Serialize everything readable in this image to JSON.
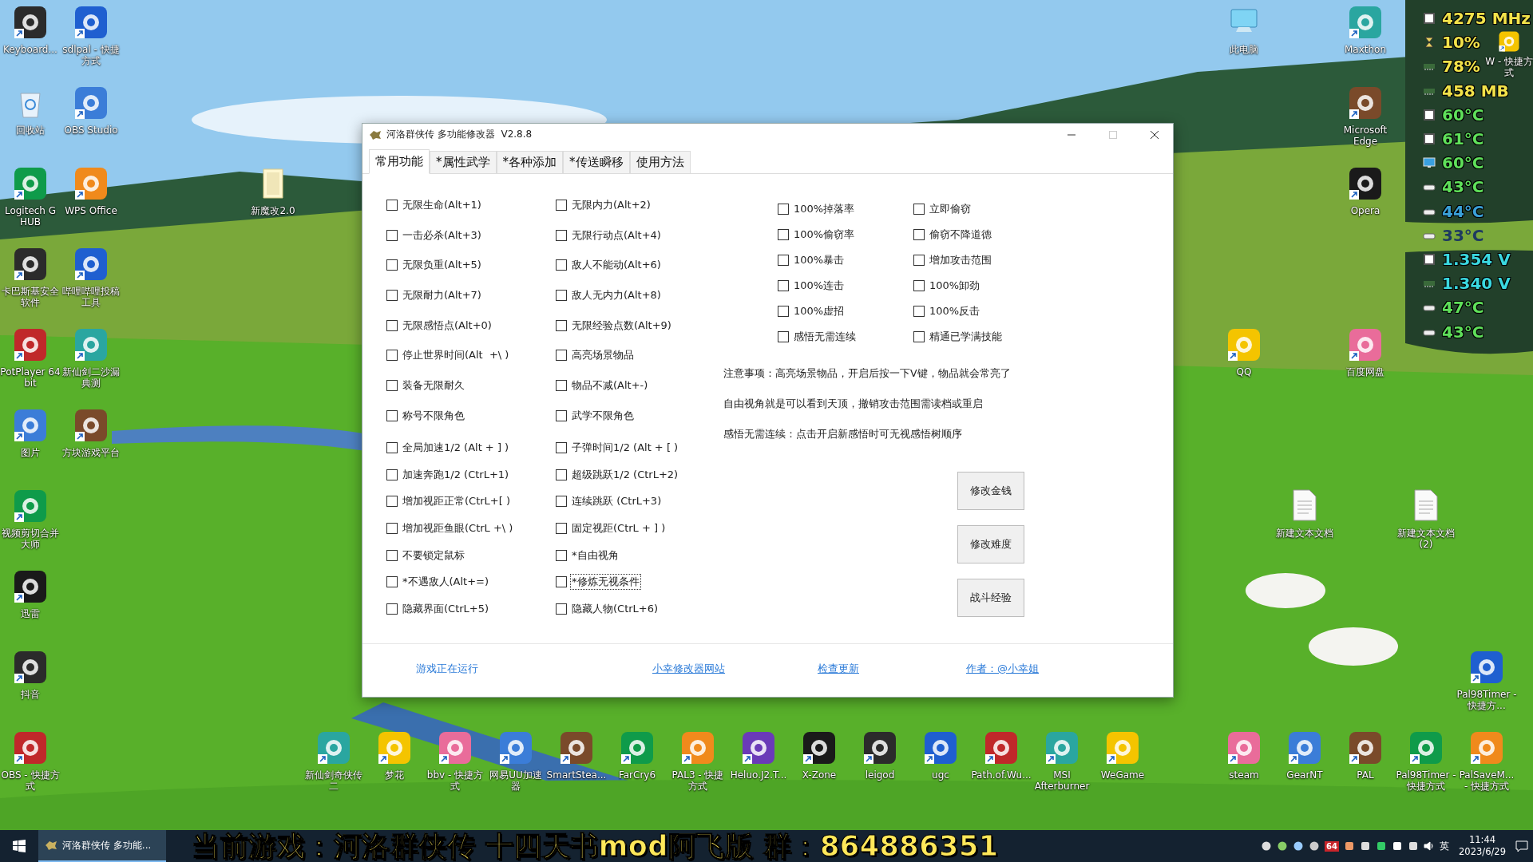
{
  "desktop_icons": [
    {
      "label": "Keyboard...",
      "kind": "app"
    },
    {
      "label": "sdlpal - 快捷方式",
      "kind": "app"
    },
    {
      "label": "此电脑",
      "kind": "computer"
    },
    {
      "label": "Maxthon",
      "kind": "app"
    },
    {
      "label": "W - 快捷方式",
      "kind": "app"
    },
    {
      "label": "回收站",
      "kind": "recycle"
    },
    {
      "label": "OBS Studio",
      "kind": "app"
    },
    {
      "label": "Microsoft Edge",
      "kind": "app"
    },
    {
      "label": "Logitech G HUB",
      "kind": "app"
    },
    {
      "label": "WPS Office",
      "kind": "app"
    },
    {
      "label": "新魔改2.0",
      "kind": "folder"
    },
    {
      "label": "Opera",
      "kind": "app"
    },
    {
      "label": "卡巴斯基安全软件",
      "kind": "app"
    },
    {
      "label": "哔哩哔哩投稿工具",
      "kind": "app"
    },
    {
      "label": "PotPlayer 64 bit",
      "kind": "app"
    },
    {
      "label": "新仙剑二沙漏典测",
      "kind": "app"
    },
    {
      "label": "QQ",
      "kind": "app"
    },
    {
      "label": "百度网盘",
      "kind": "app"
    },
    {
      "label": "图片",
      "kind": "app"
    },
    {
      "label": "方块游戏平台",
      "kind": "app"
    },
    {
      "label": "视频剪切合并大师",
      "kind": "app"
    },
    {
      "label": "新建文本文档",
      "kind": "document"
    },
    {
      "label": "新建文本文档 (2)",
      "kind": "document"
    },
    {
      "label": "迅雷",
      "kind": "app"
    },
    {
      "label": "抖音",
      "kind": "app"
    },
    {
      "label": "Pal98Timer - 快捷方...",
      "kind": "app"
    },
    {
      "label": "OBS - 快捷方式",
      "kind": "app"
    },
    {
      "label": "新仙剑奇侠传二",
      "kind": "app"
    },
    {
      "label": "梦花",
      "kind": "app"
    },
    {
      "label": "bbv - 快捷方式",
      "kind": "app"
    },
    {
      "label": "网易UU加速器",
      "kind": "app"
    },
    {
      "label": "SmartStea...",
      "kind": "app"
    },
    {
      "label": "FarCry6",
      "kind": "app"
    },
    {
      "label": "PAL3 - 快捷方式",
      "kind": "app"
    },
    {
      "label": "Heluo.J2.T...",
      "kind": "app"
    },
    {
      "label": "X-Zone",
      "kind": "app"
    },
    {
      "label": "leigod",
      "kind": "app"
    },
    {
      "label": "ugc",
      "kind": "app"
    },
    {
      "label": "Path.of.Wu...",
      "kind": "app"
    },
    {
      "label": "MSI Afterburner",
      "kind": "app"
    },
    {
      "label": "WeGame",
      "kind": "app"
    },
    {
      "label": "steam",
      "kind": "app"
    },
    {
      "label": "GearNT",
      "kind": "app"
    },
    {
      "label": "PAL",
      "kind": "app"
    },
    {
      "label": "Pal98Timer - 快捷方式",
      "kind": "app"
    },
    {
      "label": "PalSaveM... - 快捷方式",
      "kind": "app"
    }
  ],
  "sensors": [
    {
      "kind": "chip",
      "value": "4275 MHz",
      "color": "#f2e24a"
    },
    {
      "kind": "hourglass",
      "value": "10%",
      "color": "#f2e24a"
    },
    {
      "kind": "ram",
      "value": "78%",
      "color": "#f2e24a"
    },
    {
      "kind": "ram",
      "value": "458 MB",
      "color": "#f2e24a"
    },
    {
      "kind": "chip",
      "value": "60°C",
      "color": "#5fe05a"
    },
    {
      "kind": "chip",
      "value": "61°C",
      "color": "#5fe05a"
    },
    {
      "kind": "monitor",
      "value": "60°C",
      "color": "#5fe05a"
    },
    {
      "kind": "drive",
      "value": "43°C",
      "color": "#5fe05a"
    },
    {
      "kind": "drive",
      "value": "44°C",
      "color": "#3aa0d8"
    },
    {
      "kind": "drive",
      "value": "33°C",
      "color": "#1e3a60"
    },
    {
      "kind": "chip",
      "value": "1.354 V",
      "color": "#3ad8e0"
    },
    {
      "kind": "ram",
      "value": "1.340 V",
      "color": "#3ad8e0"
    },
    {
      "kind": "drive",
      "value": "47°C",
      "color": "#5fe05a"
    },
    {
      "kind": "drive",
      "value": "43°C",
      "color": "#5fe05a"
    }
  ],
  "window": {
    "title": "河洛群侠传 多功能修改器  V2.8.8",
    "maximize_disabled": true,
    "tabs": [
      {
        "label": "常用功能",
        "selected": true
      },
      {
        "label": "*属性武学",
        "selected": false
      },
      {
        "label": "*各种添加",
        "selected": false
      },
      {
        "label": "*传送瞬移",
        "selected": false
      },
      {
        "label": "使用方法",
        "selected": false
      }
    ],
    "options_group_1": [
      {
        "label": "无限生命(Alt+1)",
        "checked": false,
        "focused": false
      },
      {
        "label": "无限内力(Alt+2)",
        "checked": false,
        "focused": false
      },
      {
        "label": "一击必杀(Alt+3)",
        "checked": false,
        "focused": false
      },
      {
        "label": "无限行动点(Alt+4)",
        "checked": false,
        "focused": false
      },
      {
        "label": "无限负重(Alt+5)",
        "checked": false,
        "focused": false
      },
      {
        "label": "敌人不能动(Alt+6)",
        "checked": false,
        "focused": false
      },
      {
        "label": "无限耐力(Alt+7)",
        "checked": false,
        "focused": false
      },
      {
        "label": "敌人无内力(Alt+8)",
        "checked": false,
        "focused": false
      },
      {
        "label": "无限感悟点(Alt+0)",
        "checked": false,
        "focused": false
      },
      {
        "label": "无限经验点数(Alt+9)",
        "checked": false,
        "focused": false
      },
      {
        "label": "停止世界时间(Alt  +\\ )",
        "checked": false,
        "focused": false
      },
      {
        "label": "高亮场景物品",
        "checked": false,
        "focused": false
      },
      {
        "label": "装备无限耐久",
        "checked": false,
        "focused": false
      },
      {
        "label": "物品不减(Alt+-)",
        "checked": false,
        "focused": false
      },
      {
        "label": "称号不限角色",
        "checked": false,
        "focused": false
      },
      {
        "label": "武学不限角色",
        "checked": false,
        "focused": false
      }
    ],
    "options_group_2": [
      {
        "label": "全局加速1/2 (Alt + ] )",
        "checked": false,
        "focused": false
      },
      {
        "label": "子弹时间1/2 (Alt + [ )",
        "checked": false,
        "focused": false
      },
      {
        "label": "加速奔跑1/2 (CtrL+1)",
        "checked": false,
        "focused": false
      },
      {
        "label": "超级跳跃1/2 (CtrL+2)",
        "checked": false,
        "focused": false
      },
      {
        "label": "增加视距正常(CtrL+[ )",
        "checked": false,
        "focused": false
      },
      {
        "label": "连续跳跃 (CtrL+3)",
        "checked": false,
        "focused": false
      },
      {
        "label": "增加视距鱼眼(CtrL +\\ )",
        "checked": false,
        "focused": false
      },
      {
        "label": "固定视距(CtrL + ] )",
        "checked": false,
        "focused": false
      },
      {
        "label": "不要锁定鼠标",
        "checked": false,
        "focused": false
      },
      {
        "label": "*自由视角",
        "checked": false,
        "focused": false
      },
      {
        "label": "*不遇敌人(Alt+=)",
        "checked": false,
        "focused": false
      },
      {
        "label": "*修炼无视条件",
        "checked": false,
        "focused": true
      },
      {
        "label": "隐藏界面(CtrL+5)",
        "checked": false,
        "focused": false
      },
      {
        "label": "隐藏人物(CtrL+6)",
        "checked": false,
        "focused": false
      }
    ],
    "options_group_3": [
      {
        "label": "100%掉落率",
        "checked": false,
        "focused": false
      },
      {
        "label": "立即偷窃",
        "checked": false,
        "focused": false
      },
      {
        "label": "100%偷窃率",
        "checked": false,
        "focused": false
      },
      {
        "label": "偷窃不降道德",
        "checked": false,
        "focused": false
      },
      {
        "label": "100%暴击",
        "checked": false,
        "focused": false
      },
      {
        "label": "增加攻击范围",
        "checked": false,
        "focused": false
      },
      {
        "label": "100%连击",
        "checked": false,
        "focused": false
      },
      {
        "label": "100%卸劲",
        "checked": false,
        "focused": false
      },
      {
        "label": "100%虚招",
        "checked": false,
        "focused": false
      },
      {
        "label": "100%反击",
        "checked": false,
        "focused": false
      },
      {
        "label": "感悟无需连续",
        "checked": false,
        "focused": false
      },
      {
        "label": "精通已学满技能",
        "checked": false,
        "focused": false
      }
    ],
    "notes": [
      "注意事项：高亮场景物品，开启后按一下V键，物品就会常亮了",
      "自由视角就是可以看到天顶，撤销攻击范围需读档或重启",
      "感悟无需连续：点击开启新感悟时可无视感悟树顺序"
    ],
    "buttons": [
      "修改金钱",
      "修改难度",
      "战斗经验"
    ],
    "footer": [
      {
        "label": "游戏正在运行",
        "kind": "status"
      },
      {
        "label": "小幸修改器网站",
        "kind": "link"
      },
      {
        "label": "检查更新",
        "kind": "link"
      },
      {
        "label": "作者：@小幸姐",
        "kind": "link"
      }
    ]
  },
  "taskbar": {
    "app_button": {
      "label": "河洛群侠传 多功能...",
      "selected": true
    },
    "caption": "当前游戏：河洛群侠传 十四天书mod阿飞版 群：864886351",
    "tray_badge": "64",
    "input_method": "英",
    "time": "11:44",
    "date": "2023/6/29"
  }
}
